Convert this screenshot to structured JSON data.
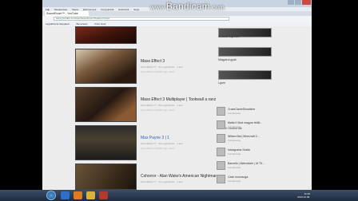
{
  "watermark": {
    "prefix": "www.",
    "brand": "Bandicam",
    "suffix": ".com"
  },
  "browser": {
    "tab_title": "SoundRoom™ - YouTube",
    "menu": [
      "Fájl",
      "Szerkesztés",
      "Nézet",
      "Előzmények",
      "Könyvjelzők",
      "Eszközök",
      "Súgó"
    ],
    "url": "www.youtube.com/user/soundroom?feature=mhee",
    "bookmarks": [
      "Legtöbbször látogatott",
      "Bevezetés",
      "Friss hírek"
    ]
  },
  "feed": [
    {
      "title": "",
      "meta": "",
      "desc": ""
    },
    {
      "title": "Mass Effect 3",
      "meta": "SoundRoom™ · 34 megtekintés · 1 éve",
      "desc": "SoundRoom feltöltött egy videót"
    },
    {
      "title": "Mass Effect 3 Multiplayer | Tookwall a ranz",
      "meta": "SoundRoom™ · 89 megtekintés · 1 éve",
      "desc": "SoundRoom feltöltött egy videót"
    },
    {
      "title": "Max Payne 3 | 1",
      "meta": "SoundRoom™ · 36 megtekintés · 1 éve",
      "desc": "SoundRoom feltöltött egy videót"
    },
    {
      "title": "Cshorror - Alan Wake's American Nightmare",
      "meta": "SoundRoom™ · 12 megtekintés · 1 éve",
      "desc": ""
    }
  ],
  "sidebar": {
    "top_items": [
      {
        "caption": "Youtube kapcsol"
      },
      {
        "caption": "Magyarul gyak"
      },
      {
        "caption": "Lgure"
      }
    ],
    "heading": "Kedvelt csatornák",
    "channels": [
      {
        "name": "CrazeGameShowtime",
        "sub": "Feliratkozás"
      },
      {
        "name": "Mafia II Mod magyar letölt...",
        "sub": "Feliratkozás"
      },
      {
        "name": "Willam Bal | Minecraft 2...",
        "sub": "Feliratkozás"
      },
      {
        "name": "Instagrams Studio",
        "sub": "Feliratkozás"
      },
      {
        "name": "Barcelle | Metroidder | M 75...",
        "sub": "Feliratkozás"
      },
      {
        "name": "Cash mososoga",
        "sub": "Feliratkozás"
      }
    ]
  },
  "taskbar": {
    "time": "11:46",
    "date": "2013.12.09."
  }
}
